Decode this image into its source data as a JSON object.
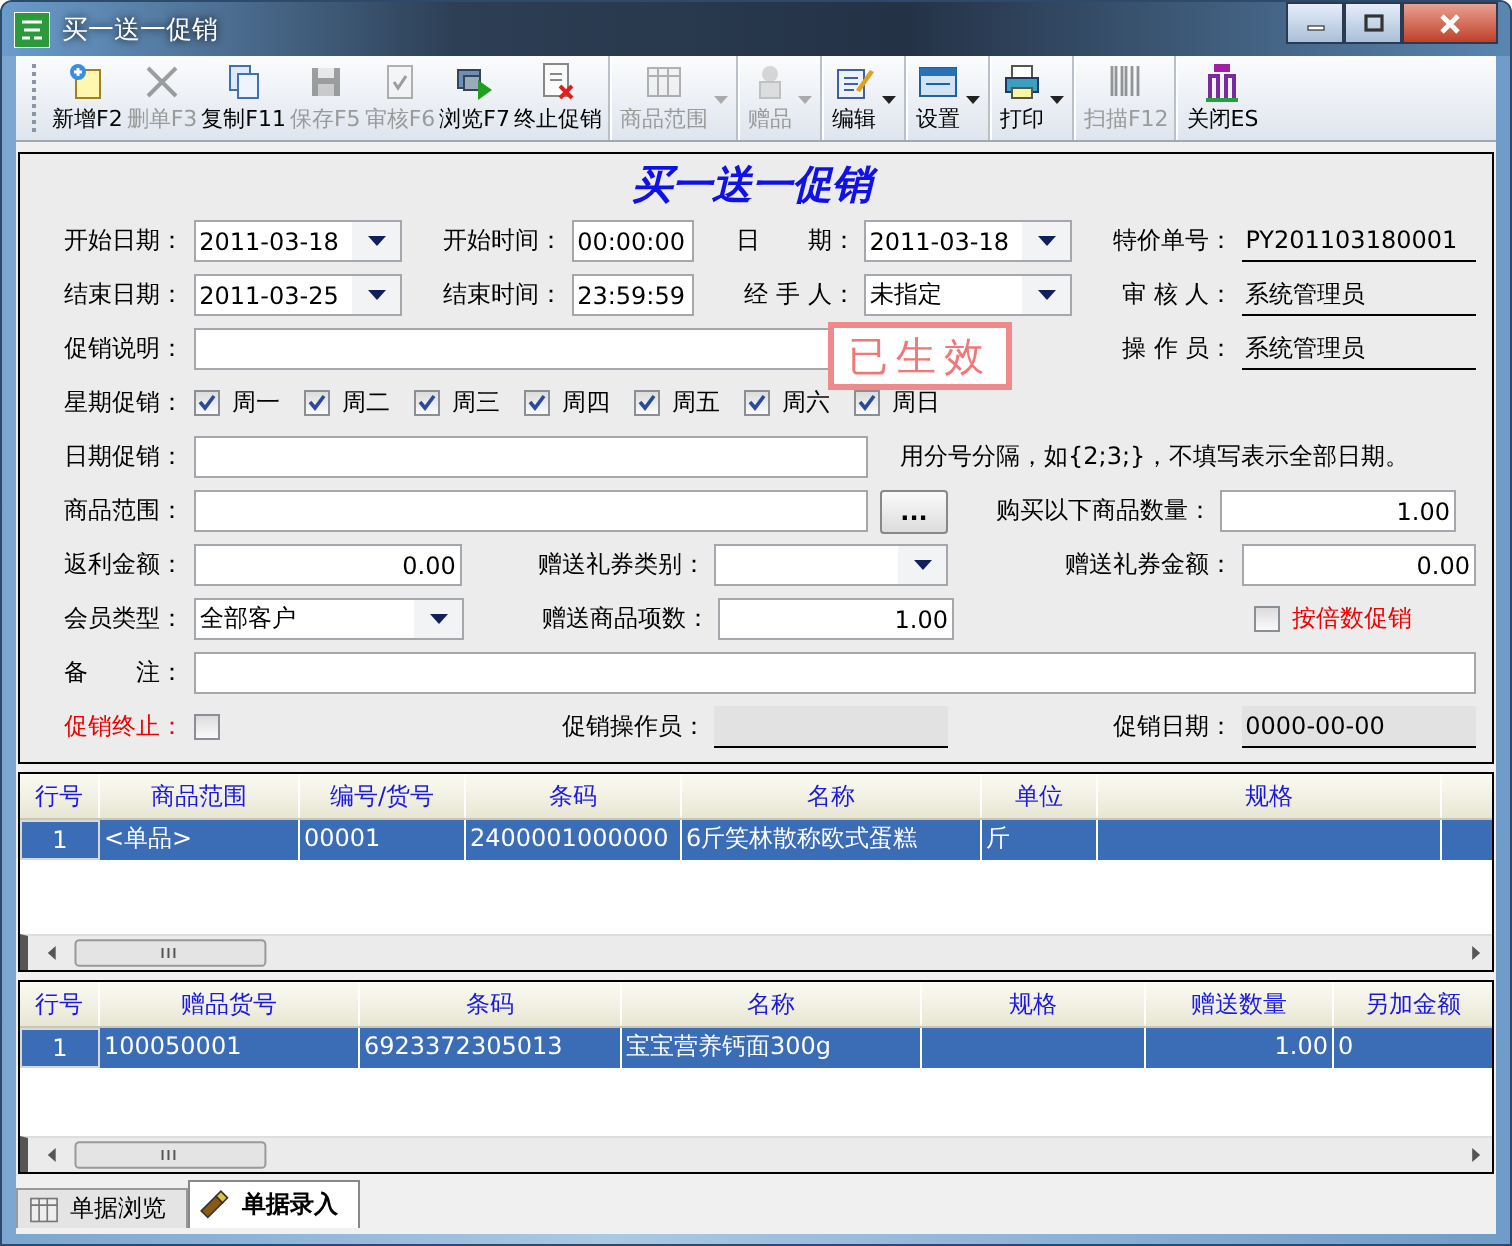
{
  "window": {
    "title": "买一送一促销"
  },
  "toolbar": [
    {
      "label": "新增F2",
      "kind": "new",
      "disabled": false,
      "dropdown": false,
      "separator": false
    },
    {
      "label": "删单F3",
      "kind": "delete",
      "disabled": true,
      "dropdown": false,
      "separator": false
    },
    {
      "label": "复制F11",
      "kind": "copy",
      "disabled": false,
      "dropdown": false,
      "separator": false
    },
    {
      "label": "保存F5",
      "kind": "save",
      "disabled": true,
      "dropdown": false,
      "separator": false
    },
    {
      "label": "审核F6",
      "kind": "check",
      "disabled": true,
      "dropdown": false,
      "separator": false
    },
    {
      "label": "浏览F7",
      "kind": "browse",
      "disabled": false,
      "dropdown": false,
      "separator": false
    },
    {
      "label": "终止促销",
      "kind": "stop",
      "disabled": false,
      "dropdown": false,
      "separator": true
    },
    {
      "label": "商品范围",
      "kind": "grid",
      "disabled": true,
      "dropdown": true,
      "separator": true
    },
    {
      "label": "赠品",
      "kind": "gift",
      "disabled": true,
      "dropdown": true,
      "separator": true
    },
    {
      "label": "编辑",
      "kind": "edit",
      "disabled": false,
      "dropdown": true,
      "separator": true
    },
    {
      "label": "设置",
      "kind": "settings",
      "disabled": false,
      "dropdown": true,
      "separator": true
    },
    {
      "label": "打印",
      "kind": "print",
      "disabled": false,
      "dropdown": true,
      "separator": true
    },
    {
      "label": "扫描F12",
      "kind": "barcode",
      "disabled": true,
      "dropdown": false,
      "separator": true
    },
    {
      "label": "关闭ES",
      "kind": "exit",
      "disabled": false,
      "dropdown": false,
      "separator": false
    }
  ],
  "form": {
    "heading": "买一送一促销",
    "stamp": "已生效",
    "start_date": {
      "label": "开始日期：",
      "value": "2011-03-18"
    },
    "start_time": {
      "label": "开始时间：",
      "value": "00:00:00"
    },
    "date": {
      "label": "日　　期：",
      "value": "2011-03-18"
    },
    "special_no": {
      "label": "特价单号：",
      "value": "PY201103180001"
    },
    "end_date": {
      "label": "结束日期：",
      "value": "2011-03-25"
    },
    "end_time": {
      "label": "结束时间：",
      "value": "23:59:59"
    },
    "handler": {
      "label": "经 手 人：",
      "value": "未指定"
    },
    "reviewer": {
      "label": "审 核 人：",
      "value": "系统管理员"
    },
    "description": {
      "label": "促销说明："
    },
    "operator": {
      "label": "操 作 员：",
      "value": "系统管理员"
    },
    "weekdays": {
      "label": "星期促销：",
      "items": [
        {
          "label": "周一",
          "checked": true
        },
        {
          "label": "周二",
          "checked": true
        },
        {
          "label": "周三",
          "checked": true
        },
        {
          "label": "周四",
          "checked": true
        },
        {
          "label": "周五",
          "checked": true
        },
        {
          "label": "周六",
          "checked": true
        },
        {
          "label": "周日",
          "checked": true
        }
      ]
    },
    "date_promo": {
      "label": "日期促销：",
      "hint": "用分号分隔，如{2;3;}，不填写表示全部日期。"
    },
    "product_range": {
      "label": "商品范围：",
      "button": "..."
    },
    "buy_qty": {
      "label": "购买以下商品数量：",
      "value": "1.00"
    },
    "rebate": {
      "label": "返利金额：",
      "value": "0.00"
    },
    "coupon_type": {
      "label": "赠送礼券类别："
    },
    "coupon_amount": {
      "label": "赠送礼券金额：",
      "value": "0.00"
    },
    "member_type": {
      "label": "会员类型：",
      "value": "全部客户"
    },
    "gift_count": {
      "label": "赠送商品项数：",
      "value": "1.00"
    },
    "multiple": {
      "label": "按倍数促销",
      "checked": false
    },
    "remark": {
      "label": "备　　注："
    },
    "terminated": {
      "label": "促销终止：",
      "checked": false
    },
    "promo_operator": {
      "label": "促销操作员："
    },
    "promo_date": {
      "label": "促销日期：",
      "value": "0000-00-00"
    }
  },
  "products_table": {
    "columns": [
      "行号",
      "商品范围",
      "编号/货号",
      "条码",
      "名称",
      "单位",
      "规格"
    ],
    "rows": [
      {
        "selected": true,
        "cells": [
          "1",
          "<单品>",
          "00001",
          "2400001000000",
          "6斤笑林散称欧式蛋糕",
          "斤",
          ""
        ]
      }
    ]
  },
  "gifts_table": {
    "columns": [
      "行号",
      "赠品货号",
      "条码",
      "名称",
      "规格",
      "赠送数量",
      "另加金额"
    ],
    "rows": [
      {
        "selected": true,
        "cells": [
          "1",
          "100050001",
          "6923372305013",
          "宝宝营养钙面300g",
          "",
          "1.00",
          "0"
        ]
      }
    ]
  },
  "tabs": [
    {
      "label": "单据浏览",
      "kind": "grid",
      "selected": false
    },
    {
      "label": "单据录入",
      "kind": "pen",
      "selected": true
    }
  ]
}
